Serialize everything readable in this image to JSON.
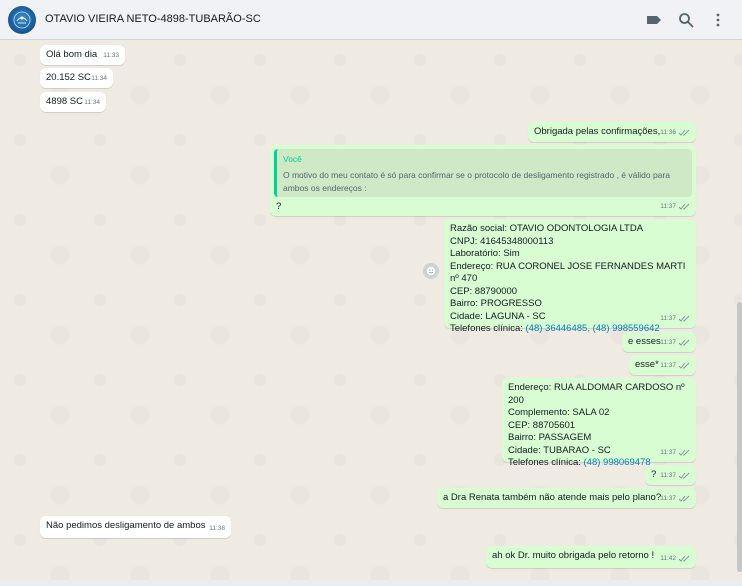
{
  "header": {
    "title": "OTAVIO VIEIRA NETO-4898-TUBARÃO-SC",
    "icons": [
      "label-icon",
      "search-icon",
      "menu-icon"
    ]
  },
  "messages": [
    {
      "dir": "in",
      "text": "Olá bom dia",
      "time": "11:33"
    },
    {
      "dir": "in",
      "text": "20.152 SC",
      "time": "11:34"
    },
    {
      "dir": "in",
      "text": "4898 SC",
      "time": "11:34"
    },
    {
      "dir": "out",
      "text": "Obrigada pelas confirmações,",
      "time": "11:36"
    },
    {
      "dir": "out",
      "quote_author": "Você",
      "quote_text": "O motivo do meu contato é só para confirmar se o protocolo de desligamento registrado , é válido para ambos os endereços :",
      "text": "?",
      "time": "11:37"
    },
    {
      "dir": "out",
      "lines": [
        "Razão social: OTAVIO ODONTOLOGIA LTDA",
        "CNPJ: 41645348000113",
        "Laboratório: Sim",
        "Endereço: RUA CORONEL JOSE FERNANDES MARTI nº 470",
        "CEP: 88790000",
        "Bairro: PROGRESSO",
        "Cidade: LAGUNA - SC"
      ],
      "phone_label": "Telefones clínica: ",
      "phone_value": "(48) 36446485, (48) 998559642",
      "time": "11:37"
    },
    {
      "dir": "out",
      "text": "e esses",
      "time": "11:37"
    },
    {
      "dir": "out",
      "text": "esse*",
      "time": "11:37"
    },
    {
      "dir": "out",
      "lines": [
        "Endereço: RUA ALDOMAR CARDOSO nº 200",
        "Complemento: SALA 02",
        "CEP: 88705601",
        "Bairro: PASSAGEM",
        "Cidade: TUBARAO - SC"
      ],
      "phone_label": "Telefones clínica: ",
      "phone_value": "(48) 998069478",
      "time": "11:37"
    },
    {
      "dir": "out",
      "text": "?",
      "time": "11:37"
    },
    {
      "dir": "out",
      "text": "a Dra Renata também não atende mais pelo plano?",
      "time": "11:37"
    },
    {
      "dir": "in",
      "text": "Não pedimos desligamento de ambos",
      "time": "11:38"
    },
    {
      "dir": "out",
      "text": "ah ok Dr. muito obrigada pelo retorno !",
      "time": "11:42"
    }
  ],
  "colors": {
    "header_bg": "#f0f2f5",
    "chat_bg": "#efeae2",
    "outgoing": "#d9fdd3",
    "incoming": "#ffffff",
    "link": "#027eb5",
    "quote_accent": "#06cf9c"
  }
}
